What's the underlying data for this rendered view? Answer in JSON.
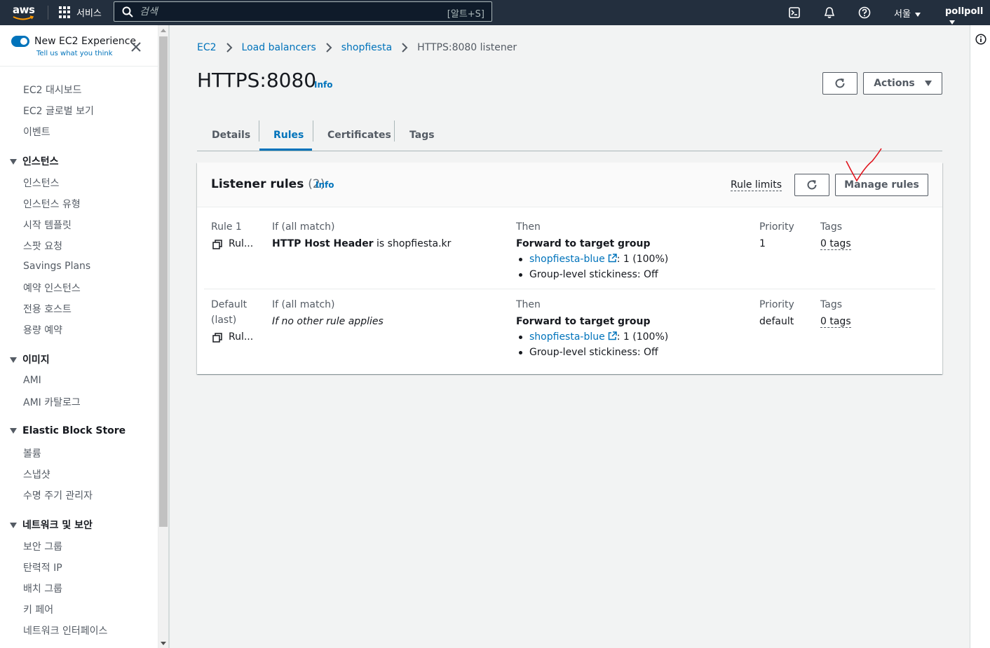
{
  "topnav": {
    "logo_text": "aws",
    "services_label": "서비스",
    "search_placeholder": "검색",
    "search_shortcut": "[알트+S]",
    "region_label": "서울",
    "user_label": "pollpoll"
  },
  "sidebar": {
    "experience_title": "New EC2 Experience",
    "experience_sub": "Tell us what you think",
    "items_top": [
      "EC2 대시보드",
      "EC2 글로벌 보기",
      "이벤트"
    ],
    "section_instances": "인스턴스",
    "items_instances": [
      "인스턴스",
      "인스턴스 유형",
      "시작 템플릿",
      "스팟 요청",
      "Savings Plans",
      "예약 인스턴스",
      "전용 호스트",
      "용량 예약"
    ],
    "section_images": "이미지",
    "items_images": [
      "AMI",
      "AMI 카탈로그"
    ],
    "section_ebs": "Elastic Block Store",
    "items_ebs": [
      "볼륨",
      "스냅샷",
      "수명 주기 관리자"
    ],
    "section_network": "네트워크 및 보안",
    "items_network": [
      "보안 그룹",
      "탄력적 IP",
      "배치 그룹",
      "키 페어",
      "네트워크 인터페이스"
    ]
  },
  "breadcrumb": {
    "items": [
      "EC2",
      "Load balancers",
      "shopfiesta"
    ],
    "current": "HTTPS:8080 listener"
  },
  "header": {
    "title": "HTTPS:8080",
    "info": "Info",
    "actions_label": "Actions"
  },
  "tabs": [
    "Details",
    "Rules",
    "Certificates",
    "Tags"
  ],
  "listener_rules": {
    "title": "Listener rules",
    "count": "(2)",
    "info": "Info",
    "rule_limits": "Rule limits",
    "manage_rules": "Manage rules",
    "rows": [
      {
        "name": "Rule 1",
        "arn_truncated": "Rul...",
        "cond_label": "If (all match)",
        "cond_field": "HTTP Host Header",
        "cond_rest": " is shopfiesta.kr",
        "then_label": "Then",
        "action": "Forward to target group",
        "target_group": "shopfiesta-blue",
        "weight": ": 1 (100%)",
        "stickiness": "Group-level stickiness: Off",
        "priority_label": "Priority",
        "priority": "1",
        "tags_label": "Tags",
        "tags": "0 tags"
      },
      {
        "name": "Default",
        "name2": "(last)",
        "arn_truncated": "Rul...",
        "cond_label": "If (all match)",
        "cond_text": "If no other rule applies",
        "then_label": "Then",
        "action": "Forward to target group",
        "target_group": "shopfiesta-blue",
        "weight": ": 1 (100%)",
        "stickiness": "Group-level stickiness: Off",
        "priority_label": "Priority",
        "priority": "default",
        "tags_label": "Tags",
        "tags": "0 tags"
      }
    ]
  },
  "colors": {
    "nav_bg": "#232f3e",
    "link": "#0073bb",
    "annotation": "#e0161f"
  }
}
